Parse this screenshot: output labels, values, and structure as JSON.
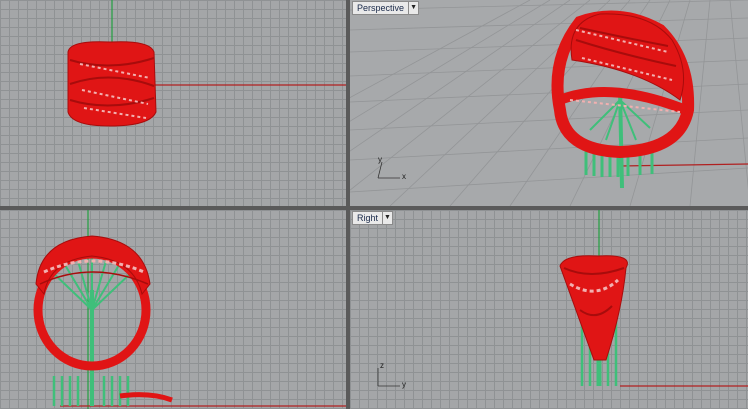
{
  "viewports": {
    "perspective": {
      "label": "Perspective",
      "axis_x": "x",
      "axis_y": "y"
    },
    "right": {
      "label": "Right",
      "axis_x": "y",
      "axis_y": "z"
    }
  },
  "colors": {
    "ring": "#e01515",
    "ring_dark": "#a80c0c",
    "support": "#3fbf7a",
    "grid": "#8f9294",
    "background": "#a4a6a8",
    "x_axis": "#b02020",
    "y_axis": "#20a040"
  },
  "icons": [
    "chevron-down-icon"
  ]
}
